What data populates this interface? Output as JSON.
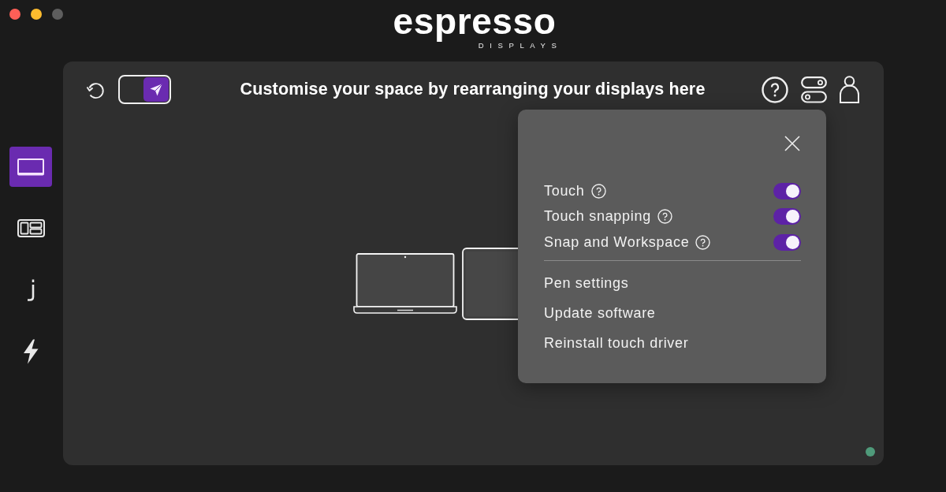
{
  "window": {
    "controls": [
      {
        "kind": "close",
        "disabled": false
      },
      {
        "kind": "minimize",
        "disabled": false
      },
      {
        "kind": "zoom",
        "disabled": true
      }
    ]
  },
  "logo": {
    "wordmark": "espresso",
    "subtitle": "DISPLAYS"
  },
  "sidebar": {
    "items": [
      {
        "kind": "screen",
        "selected": true
      },
      {
        "kind": "layout",
        "selected": false
      },
      {
        "kind": "hook",
        "selected": false
      },
      {
        "kind": "bolt",
        "selected": false
      }
    ]
  },
  "toolbar": {
    "mode_toggle": {
      "on": true
    },
    "title": "Customise your space by rearranging your displays here"
  },
  "settings_popup": {
    "toggles": [
      {
        "label": "Touch",
        "on": true
      },
      {
        "label": "Touch snapping",
        "on": true
      },
      {
        "label": "Snap and Workspace",
        "on": true
      }
    ],
    "links": [
      "Pen settings",
      "Update software",
      "Reinstall touch driver"
    ]
  }
}
